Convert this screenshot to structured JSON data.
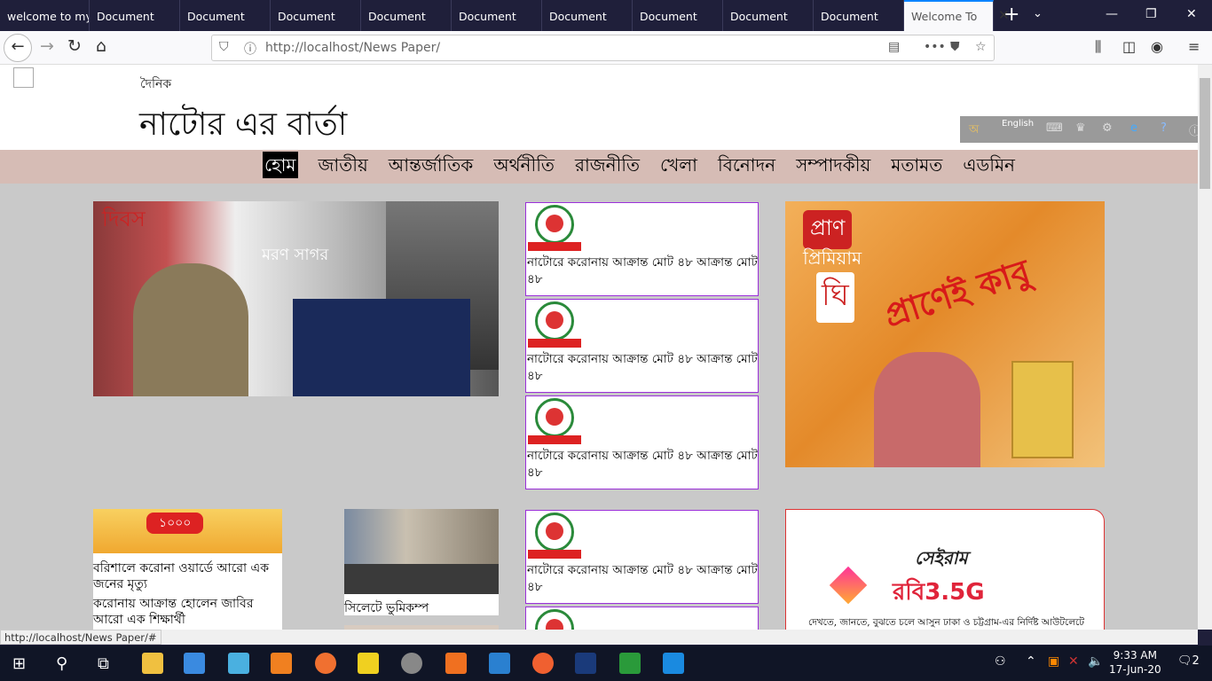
{
  "browser": {
    "tabs": [
      {
        "label": "welcome to my"
      },
      {
        "label": "Document"
      },
      {
        "label": "Document"
      },
      {
        "label": "Document"
      },
      {
        "label": "Document"
      },
      {
        "label": "Document"
      },
      {
        "label": "Document"
      },
      {
        "label": "Document"
      },
      {
        "label": "Document"
      },
      {
        "label": "Document"
      },
      {
        "label": "Welcome To"
      }
    ],
    "url_host": "http://localhost/",
    "url_path": "News Paper/",
    "status_url": "http://localhost/News Paper/#"
  },
  "site": {
    "prefix": "দৈনিক",
    "title": "নাটোর এর বার্তা",
    "language_toolbar": {
      "lang_label": "English",
      "lang_icon_letter": "অ"
    },
    "menu": [
      {
        "label": "হোম"
      },
      {
        "label": "জাতীয়"
      },
      {
        "label": "আন্তর্জাতিক"
      },
      {
        "label": "অর্থনীতি"
      },
      {
        "label": "রাজনীতি"
      },
      {
        "label": "খেলা"
      },
      {
        "label": "বিনোদন"
      },
      {
        "label": "সম্পাদকীয়"
      },
      {
        "label": "মতামত"
      },
      {
        "label": "এডমিন"
      }
    ]
  },
  "hero": {
    "banner_text": "দিবস",
    "banner_text2": "মরণ সাগর"
  },
  "side_news": [
    {
      "text": "নাটোরে করোনায় আক্রান্ত মোট ৪৮ আক্রান্ত মোট ৪৮"
    },
    {
      "text": "নাটোরে করোনায় আক্রান্ত মোট ৪৮ আক্রান্ত মোট ৪৮"
    },
    {
      "text": "নাটোরে করোনায় আক্রান্ত মোট ৪৮ আক্রান্ত মোট ৪৮"
    },
    {
      "text": "নাটোরে করোনায় আক্রান্ত মোট ৪৮ আক্রান্ত মোট ৪৮"
    }
  ],
  "ad_pran": {
    "brand": "প্রাণ",
    "line2": "প্রিমিয়াম",
    "line3": "ঘি",
    "slogan": "প্রাণেই কাবু"
  },
  "left_news": {
    "badge": "১০০০",
    "headline1": "বরিশালে করোনা ওয়ার্ডে আরো এক জনের মৃত্যু",
    "headline2": "করোনায় আক্রান্ত হোলেন জাবির আরো এক শিক্ষার্থী"
  },
  "middle_news": {
    "headline": "সিলেটে ভুমিকম্প"
  },
  "ad_robi": {
    "tag": "সেইরাম",
    "brand": "রবি3.5G",
    "subtitle": "দেখতে, জানতে, বুঝতে চলে আসুন ঢাকা ও চট্টগ্রাম-এর নির্দিষ্ট আউটলেটে"
  },
  "taskbar": {
    "time": "9:33 AM",
    "date": "17-Jun-20",
    "notifications": "2"
  }
}
